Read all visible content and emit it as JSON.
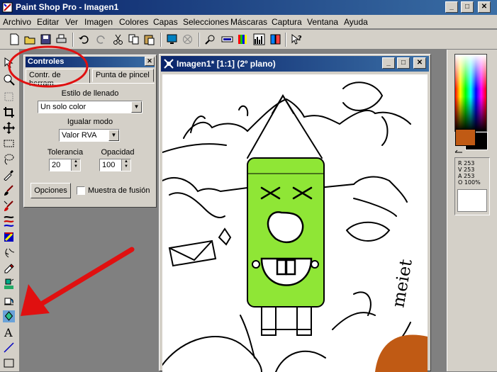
{
  "window": {
    "title": "Paint Shop Pro - Imagen1"
  },
  "menu": [
    "Archivo",
    "Editar",
    "Ver",
    "Imagen",
    "Colores",
    "Capas",
    "Selecciones",
    "Máscaras",
    "Captura",
    "Ventana",
    "Ayuda"
  ],
  "toolbar": {
    "icons": [
      "new-icon",
      "open-icon",
      "save-icon",
      "print-icon",
      "undo-icon",
      "redo-icon",
      "cut-icon",
      "copy-icon",
      "paste-icon",
      "screen-icon",
      "browse-icon",
      "zoom-icon",
      "toolbar-icon",
      "palette-icon",
      "histogram-icon",
      "layers-icon",
      "help-icon"
    ]
  },
  "tools": [
    "arrow-icon",
    "zoom-tool-icon",
    "deform-icon",
    "crop-icon",
    "move-icon",
    "selection-icon",
    "freehand-icon",
    "dropper-icon",
    "brush-icon",
    "clone-icon",
    "replace-color-icon",
    "retouch-icon",
    "eraser-icon",
    "picture-tube-icon",
    "airbrush-icon",
    "flood-fill-icon",
    "text-icon",
    "line-icon",
    "shape-icon"
  ],
  "controls": {
    "title": "Controles",
    "tab1": "Contr. de herram.",
    "tab2": "Punta de pincel",
    "fill_label": "Estilo de llenado",
    "fill_value": "Un solo color",
    "match_label": "Igualar modo",
    "match_value": "Valor RVA",
    "tolerance_label": "Tolerancia",
    "tolerance_value": "20",
    "opacity_label": "Opacidad",
    "opacity_value": "100",
    "options_button": "Opciones",
    "merge_label": "Muestra de fusión"
  },
  "image_window": {
    "title": "Imagen1* [1:1] (2º plano)"
  },
  "color_info": {
    "r": "R 253",
    "v": "V 253",
    "a": "A 253",
    "o": "O 100%"
  },
  "colors": {
    "foreground": "#c05a14",
    "background": "#000000",
    "fill_green": "#8fe636",
    "annotation": "#e01010"
  }
}
